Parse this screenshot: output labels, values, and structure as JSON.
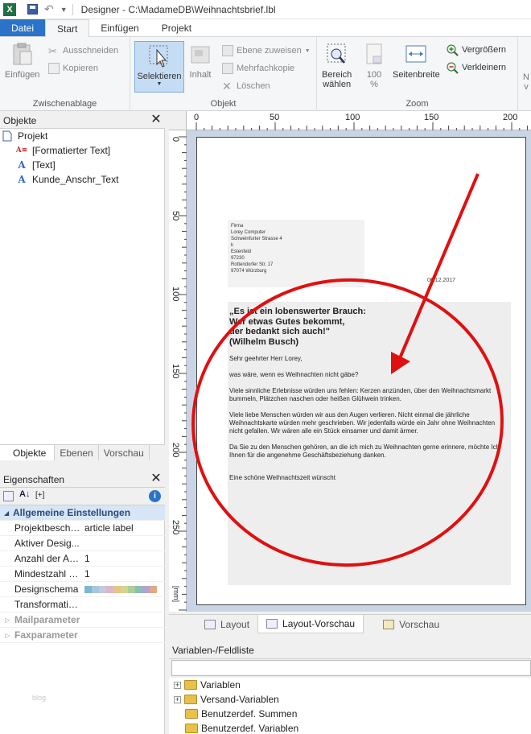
{
  "window": {
    "title": "Designer - C:\\MadameDB\\Weihnachtsbrief.lbl",
    "app_icon": "X"
  },
  "tabs": [
    "Datei",
    "Start",
    "Einfügen",
    "Projekt"
  ],
  "ribbon": {
    "clipboard": {
      "label": "Zwischenablage",
      "paste": "Einfügen",
      "cut": "Ausschneiden",
      "copy": "Kopieren"
    },
    "object": {
      "label": "Objekt",
      "select": "Selektieren",
      "content": "Inhalt",
      "assign_layer": "Ebene zuweisen",
      "multiple_copy": "Mehrfachkopie",
      "delete": "Löschen"
    },
    "zoom": {
      "label": "Zoom",
      "select_area_line1": "Bereich",
      "select_area_line2": "wählen",
      "percent_line1": "100",
      "percent_line2": "%",
      "page_width": "Seitenbreite",
      "zoom_in": "Vergrößern",
      "zoom_out": "Verkleinern",
      "cut_off_line1": "N",
      "cut_off_line2": "v"
    }
  },
  "objects_panel": {
    "title": "Objekte",
    "tree": [
      {
        "label": "Projekt",
        "icon": "page-icon"
      },
      {
        "label": "[Formatierter Text]",
        "icon": "formatted-text-icon"
      },
      {
        "label": "[Text]",
        "icon": "text-icon"
      },
      {
        "label": "Kunde_Anschr_Text",
        "icon": "text-icon"
      }
    ],
    "tabs": [
      "Objekte",
      "Ebenen",
      "Vorschau"
    ]
  },
  "properties_panel": {
    "title": "Eigenschaften",
    "toolbar_text": "[+]",
    "header": "Allgemeine Einstellungen",
    "rows": [
      {
        "name": "Projektbeschr...",
        "value": "article label"
      },
      {
        "name": "Aktiver Desig...",
        "value": ""
      },
      {
        "name": "Anzahl der Au...",
        "value": "1"
      },
      {
        "name": "Mindestzahl d...",
        "value": "1"
      },
      {
        "name": "Designschema",
        "value": ""
      },
      {
        "name": "Transformatio...",
        "value": ""
      }
    ],
    "sections": [
      "Mailparameter",
      "Faxparameter"
    ],
    "palette_colors": [
      "#7eb7d6",
      "#a6c8dd",
      "#c7c7e0",
      "#d9b8c9",
      "#e7c48b",
      "#d6d48e",
      "#a9cf9a",
      "#89c1b3",
      "#b1a4d0",
      "#e1a98a"
    ]
  },
  "ruler": {
    "h": [
      "0",
      "50",
      "100",
      "150",
      "200"
    ],
    "v": [
      "0",
      "50",
      "100",
      "150",
      "200",
      "250"
    ],
    "unit": "[mm]"
  },
  "document": {
    "address": [
      "Firma",
      "Lorey Computer",
      "Schweinfurter Strasse 4",
      "k",
      "Estenfeld",
      "97230",
      "Rottendorfer Str. 17",
      "97074 Würzburg"
    ],
    "date": "06.12.2017",
    "quote": [
      "„Es ist ein lobenswerter Brauch:",
      "Wer etwas Gutes bekommt,",
      "der bedankt sich auch!\"",
      "(Wilhelm Busch)"
    ],
    "salutation": "Sehr geehrter Herr Lorey,",
    "paragraphs": [
      "was wäre, wenn es Weihnachten nicht gäbe?",
      "Viele sinnliche Erlebnisse würden uns fehlen: Kerzen anzünden, über den Weihnachtsmarkt bummeln, Plätzchen naschen oder heißen Glühwein trinken.",
      "Viele liebe Menschen würden wir aus den Augen verlieren. Nicht einmal die jährliche Weihnachtskarte würden mehr geschrieben. Wir jedenfalls würde ein Jahr ohne Weihnachten nicht gefallen. Wir wären alle ein Stück einsamer und damit ärmer.",
      "Da Sie zu den Menschen gehören, an die ich mich zu Weihnachten gerne erinnere, möchte Ich Ihnen für die angenehme Geschäftsbeziehung danken.",
      "Eine schöne Weihnachtszeit wünscht"
    ]
  },
  "bottom_tabs": [
    "Layout",
    "Layout-Vorschau",
    "Vorschau"
  ],
  "variables_panel": {
    "title": "Variablen-/Feldliste",
    "items": [
      "Variablen",
      "Versand-Variablen",
      "Benutzerdef. Summen",
      "Benutzerdef. Variablen"
    ]
  },
  "watermark": "blog",
  "annotation_color": "#e01010"
}
